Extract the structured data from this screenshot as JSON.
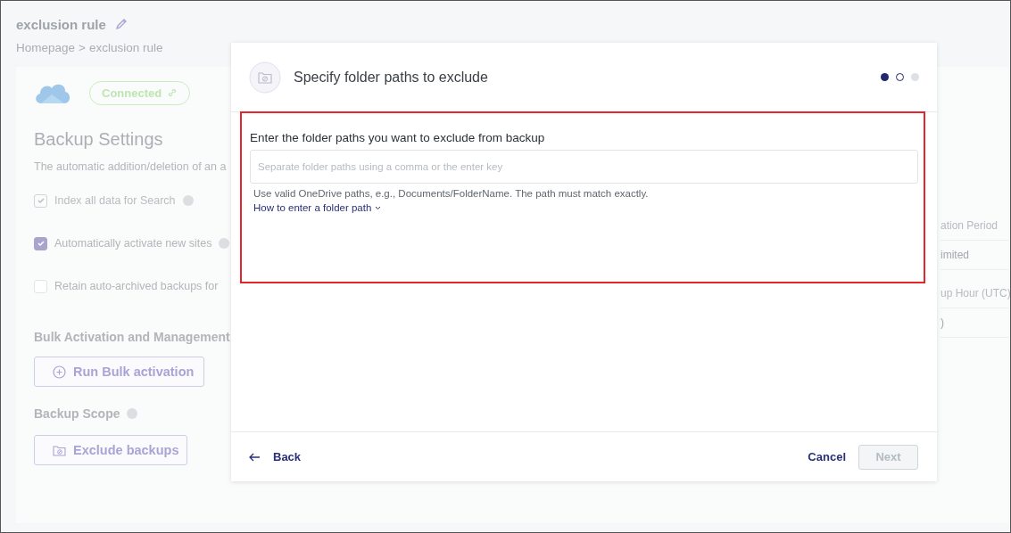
{
  "page": {
    "title": "exclusion rule",
    "breadcrumb": [
      "Homepage",
      ">",
      "exclusion rule"
    ]
  },
  "connection": {
    "status": "Connected"
  },
  "backup_settings": {
    "heading": "Backup Settings",
    "description": "The automatic addition/deletion of an a",
    "options": [
      {
        "label": "Index all data for Search",
        "checked": true,
        "disabled": true,
        "info": true
      },
      {
        "label": "Automatically activate new sites",
        "checked": true,
        "disabled": false,
        "info": true
      },
      {
        "label": "Retain auto-archived backups for",
        "checked": false,
        "disabled": false,
        "info": false
      }
    ]
  },
  "bulk": {
    "heading": "Bulk Activation and Management",
    "button": "Run Bulk activation"
  },
  "scope": {
    "heading": "Backup Scope",
    "button": "Exclude backups"
  },
  "right_column": [
    {
      "kind": "label",
      "text": "ation Period"
    },
    {
      "kind": "value",
      "text": "imited"
    },
    {
      "kind": "label",
      "text": "up Hour (UTC)"
    },
    {
      "kind": "value",
      "text": ")"
    }
  ],
  "dialog": {
    "title": "Specify folder paths to exclude",
    "steps": [
      {
        "kind": "current"
      },
      {
        "kind": "next"
      },
      {
        "kind": "later"
      }
    ],
    "field_label": "Enter the folder paths you want to exclude from backup",
    "field": {
      "placeholder": "Separate folder paths using a comma or the enter key"
    },
    "hint": "Use valid OneDrive paths, e.g., Documents/FolderName. The path must match exactly.",
    "help_link": "How to enter a folder path",
    "back": "Back",
    "cancel": "Cancel",
    "next": {
      "label": "Next",
      "disabled": true
    }
  }
}
